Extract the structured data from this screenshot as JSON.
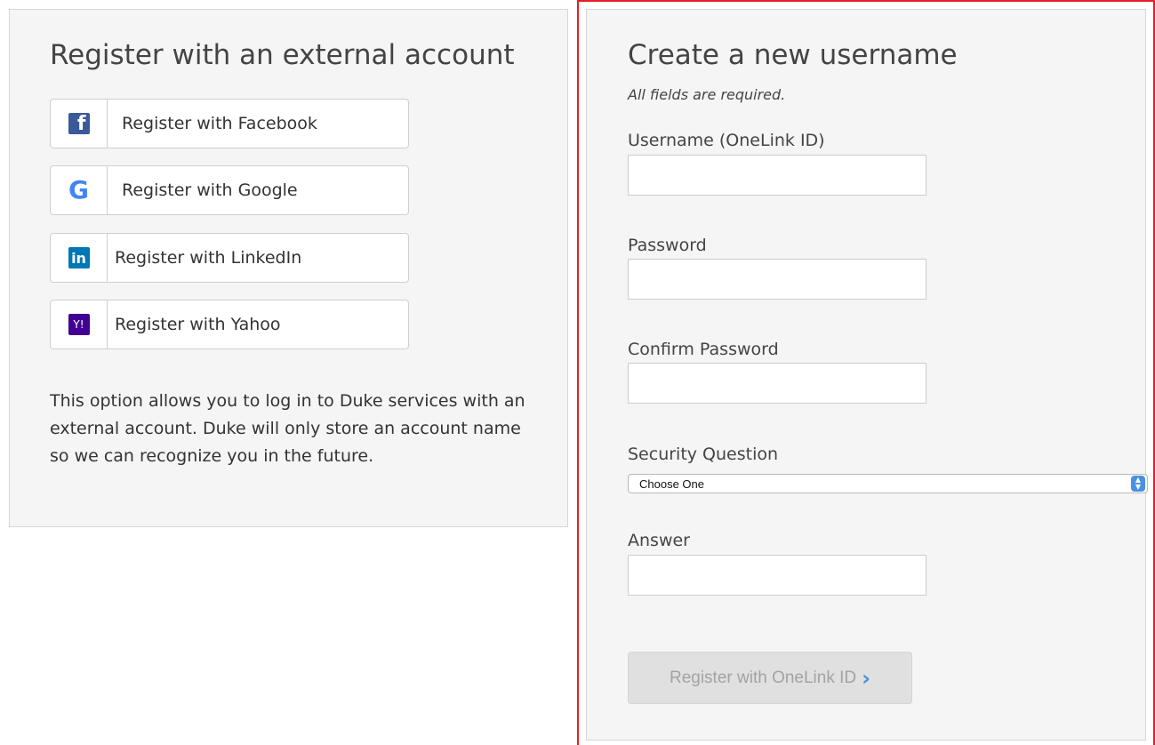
{
  "external": {
    "title": "Register with an external account",
    "buttons": [
      {
        "label": "Register with Facebook",
        "icon": "facebook-icon",
        "glyph": "f"
      },
      {
        "label": "Register with Google",
        "icon": "google-icon",
        "glyph": "G"
      },
      {
        "label": "Register with LinkedIn",
        "icon": "linkedin-icon",
        "glyph": "in"
      },
      {
        "label": "Register with Yahoo",
        "icon": "yahoo-icon",
        "glyph": "Y!"
      }
    ],
    "description": "This option allows you to log in to Duke services with an external account. Duke will only store an account name so we can recognize you in the future."
  },
  "form": {
    "title": "Create a new username",
    "required_note": "All fields are required.",
    "username_label": "Username (OneLink ID)",
    "username_value": "",
    "password_label": "Password",
    "password_value": "",
    "confirm_label": "Confirm Password",
    "confirm_value": "",
    "security_label": "Security Question",
    "security_selected": "Choose One",
    "answer_label": "Answer",
    "answer_value": "",
    "submit_label": "Register with OneLink ID",
    "submit_chevron": "›"
  },
  "colors": {
    "facebook": "#3b5998",
    "linkedin": "#0077b5",
    "yahoo": "#410093",
    "google_blue": "#4285f4",
    "highlight_frame": "#e31e24",
    "accent": "#4a90e2"
  }
}
